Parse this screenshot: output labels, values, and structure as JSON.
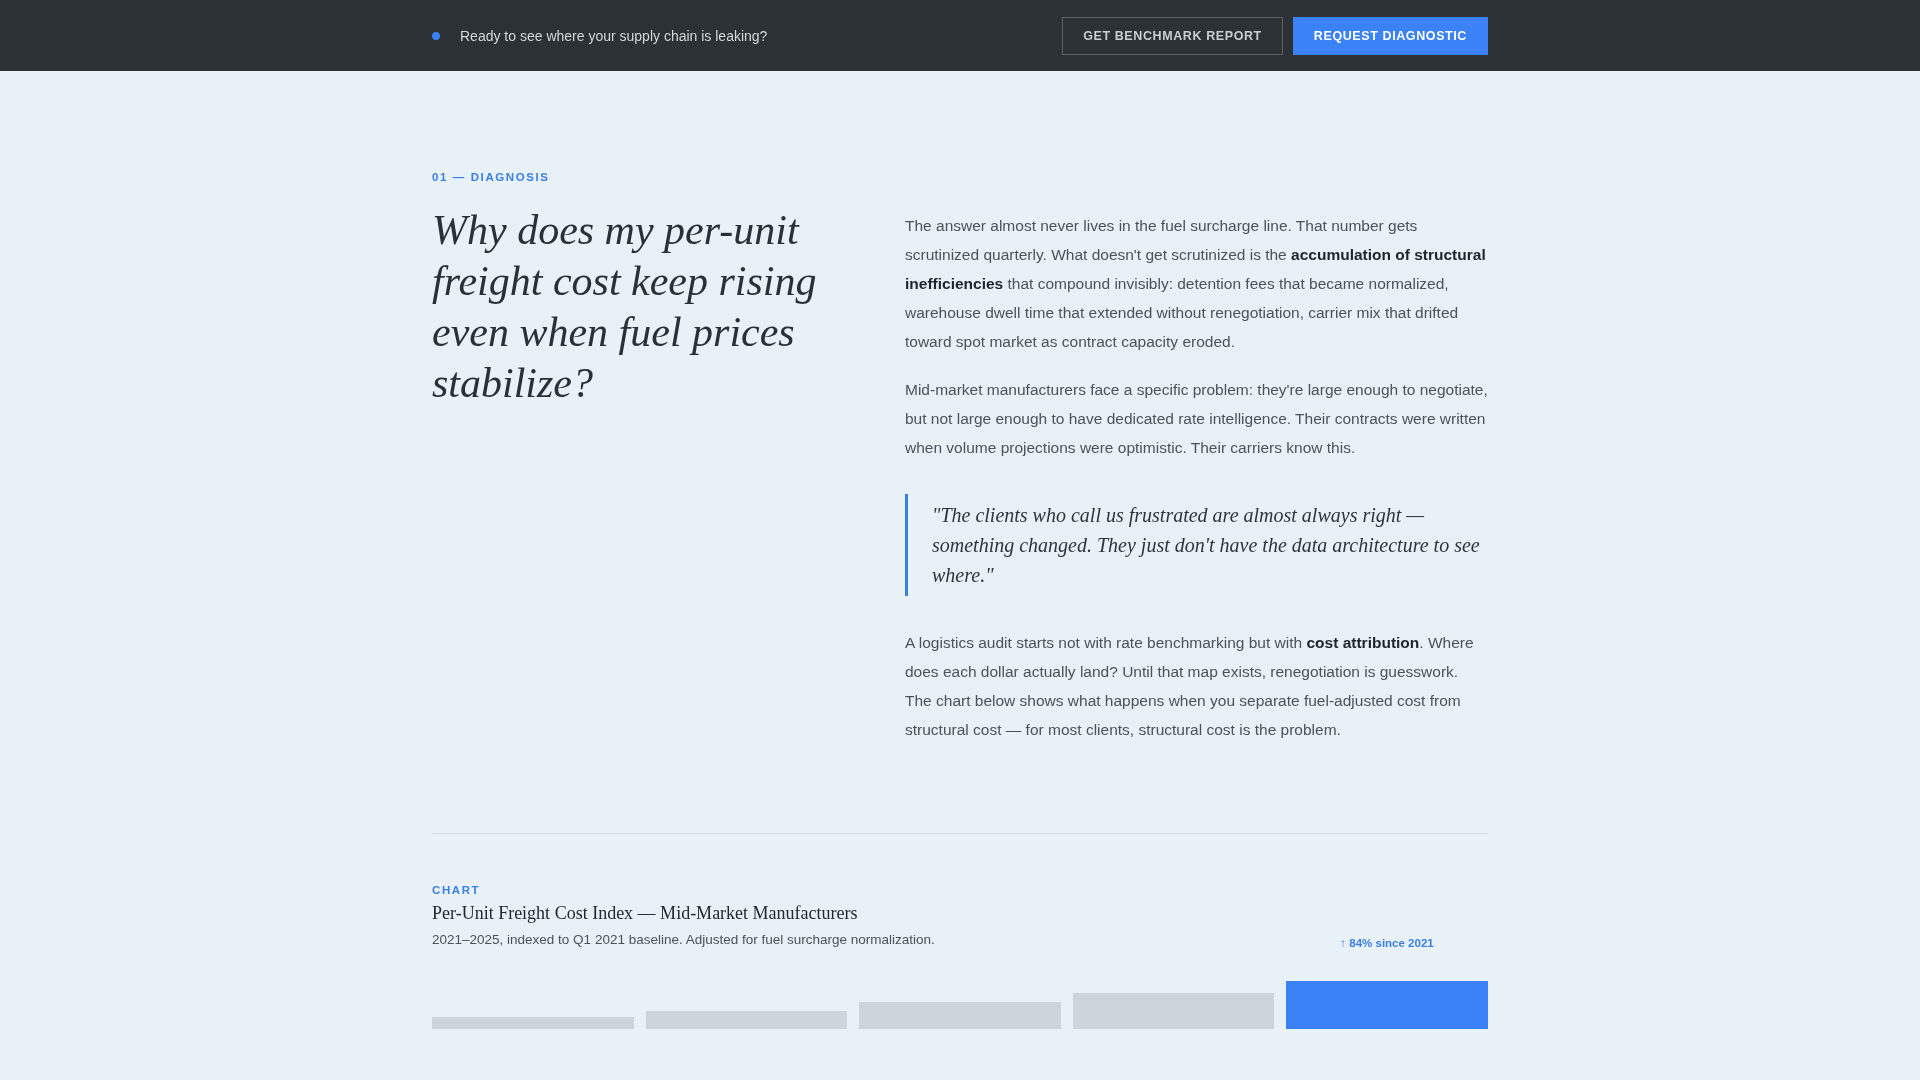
{
  "top_bar": {
    "message": "Ready to see where your supply chain is leaking?",
    "buttons": [
      {
        "label": "GET BENCHMARK REPORT",
        "kind": "outline"
      },
      {
        "label": "REQUEST DIAGNOSTIC",
        "kind": "primary"
      }
    ]
  },
  "section": {
    "eyebrow": "01 — DIAGNOSIS",
    "heading": "Why does my per-unit freight cost keep rising even when fuel prices stabilize?",
    "body": [
      {
        "kind": "paragraph",
        "text": "The answer almost never lives in the fuel surcharge line. That number gets scrutinized quarterly. What doesn't get scrutinized is the **accumulation of structural inefficiencies** that compound invisibly: detention fees that became normalized, warehouse dwell time that extended without renegotiation, carrier mix that drifted toward spot market as contract capacity eroded."
      },
      {
        "kind": "paragraph",
        "text": "Mid-market manufacturers face a specific problem: they're large enough to negotiate, but not large enough to have dedicated rate intelligence. Their contracts were written when volume projections were optimistic. Their carriers know this."
      },
      {
        "kind": "quote",
        "text": "\"The clients who call us frustrated are almost always right — something changed. They just don't have the data architecture to see where.\""
      },
      {
        "kind": "paragraph",
        "text": "A logistics audit starts not with rate benchmarking but with **cost attribution**. Where does each dollar actually land? Until that map exists, renegotiation is guesswork. The chart below shows what happens when you separate fuel-adjusted cost from structural cost — for most clients, structural cost is the problem."
      }
    ]
  },
  "chart": {
    "eyebrow": "CHART",
    "title": "Per-Unit Freight Cost Index — Mid-Market Manufacturers",
    "subtitle": "2021–2025, indexed to Q1 2021 baseline. Adjusted for fuel surcharge normalization.",
    "annotation": "↑ 84% since 2021",
    "bars": [
      {
        "highlighted": false
      },
      {
        "highlighted": false
      },
      {
        "highlighted": false
      },
      {
        "highlighted": false
      },
      {
        "highlighted": true
      }
    ]
  }
}
